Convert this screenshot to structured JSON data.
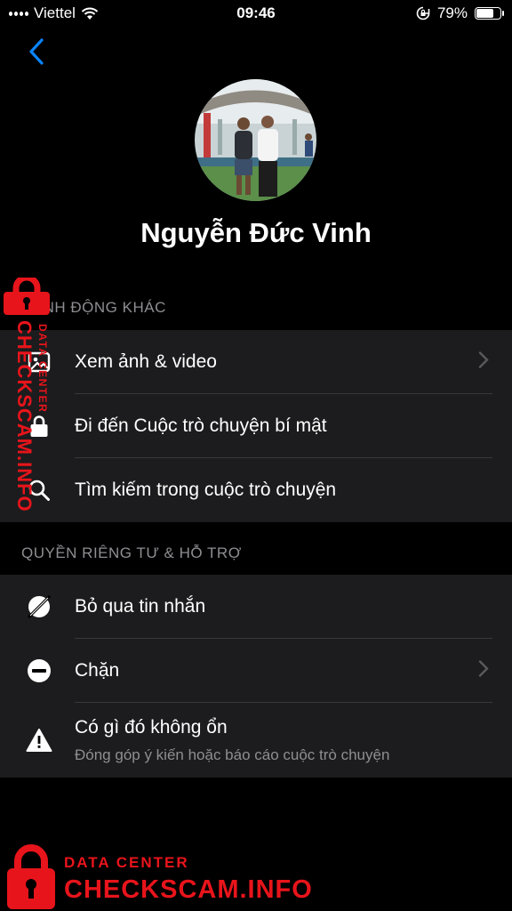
{
  "status_bar": {
    "carrier": "Viettel",
    "time": "09:46",
    "battery": "79%",
    "battery_level": 0.79
  },
  "profile": {
    "name": "Nguyễn Đức Vinh"
  },
  "sections": [
    {
      "header": "HÀNH ĐỘNG KHÁC",
      "items": [
        {
          "label": "Xem ảnh & video",
          "icon": "photo-icon",
          "chevron": true
        },
        {
          "label": "Đi đến Cuộc trò chuyện bí mật",
          "icon": "lock-icon",
          "chevron": false
        },
        {
          "label": "Tìm kiếm trong cuộc trò chuyện",
          "icon": "search-icon",
          "chevron": false
        }
      ]
    },
    {
      "header": "QUYỀN RIÊNG TƯ & HỖ TRỢ",
      "items": [
        {
          "label": "Bỏ qua tin nhắn",
          "icon": "ignore-icon",
          "chevron": false
        },
        {
          "label": "Chặn",
          "icon": "block-icon",
          "chevron": true
        },
        {
          "label": "Có gì đó không ổn",
          "sublabel": "Đóng góp ý kiến hoặc báo cáo cuộc trò chuyện",
          "icon": "warning-icon",
          "chevron": false
        }
      ]
    }
  ],
  "watermark": {
    "line1": "DATA CENTER",
    "line2": "CHECKSCAM.INFO",
    "color": "#e8141b"
  },
  "colors": {
    "accent": "#0a84ff",
    "background": "#000000",
    "row_bg": "#1c1c1e",
    "secondary_text": "#8e8e93"
  }
}
